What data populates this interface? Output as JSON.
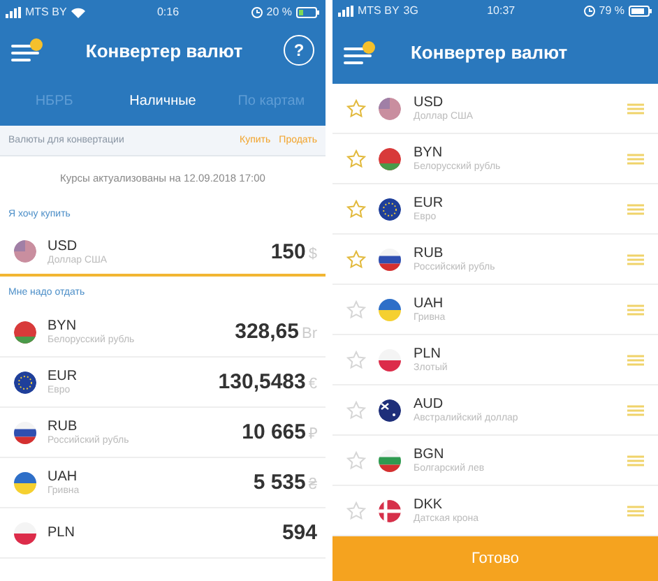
{
  "converter_screen": {
    "status_bar": {
      "carrier": "MTS BY",
      "time": "0:16",
      "battery": "20 %"
    },
    "title": "Конвертер валют",
    "help": "?",
    "tabs": [
      {
        "label": "НБРБ",
        "selected": false
      },
      {
        "label": "Наличные",
        "selected": true
      },
      {
        "label": "По картам",
        "selected": false
      }
    ],
    "section_bar": {
      "label": "Валюты для конвертации",
      "actions": [
        "Купить",
        "Продать"
      ]
    },
    "rates_note": "Курсы актуализованы на 12.09.2018 17:00",
    "buy_label": "Я хочу купить",
    "buy": {
      "code": "USD",
      "name": "Доллар США",
      "amount": "150",
      "symbol": "$"
    },
    "give_label": "Мне надо отдать",
    "give": [
      {
        "code": "BYN",
        "name": "Белорусский рубль",
        "amount": "328,65",
        "symbol": "Br"
      },
      {
        "code": "EUR",
        "name": "Евро",
        "amount": "130,5483",
        "symbol": "€"
      },
      {
        "code": "RUB",
        "name": "Российский рубль",
        "amount": "10 665",
        "symbol": "₽"
      },
      {
        "code": "UAH",
        "name": "Гривна",
        "amount": "5 535",
        "symbol": "₴"
      },
      {
        "code": "PLN",
        "amount": "594"
      }
    ]
  },
  "currency_list_screen": {
    "status_bar": {
      "carrier": "MTS BY",
      "network": "3G",
      "time": "10:37",
      "battery": "79 %"
    },
    "title": "Конвертер валют",
    "currencies": [
      {
        "code": "USD",
        "name": "Доллар США",
        "favorite": true
      },
      {
        "code": "BYN",
        "name": "Белорусский рубль",
        "favorite": true
      },
      {
        "code": "EUR",
        "name": "Евро",
        "favorite": true
      },
      {
        "code": "RUB",
        "name": "Российский рубль",
        "favorite": true
      },
      {
        "code": "UAH",
        "name": "Гривна",
        "favorite": false
      },
      {
        "code": "PLN",
        "name": "Злотый",
        "favorite": false
      },
      {
        "code": "AUD",
        "name": "Австралийский доллар",
        "favorite": false
      },
      {
        "code": "BGN",
        "name": "Болгарский лев",
        "favorite": false
      },
      {
        "code": "DKK",
        "name": "Датская крона",
        "favorite": false
      }
    ],
    "done_button": "Готово"
  }
}
